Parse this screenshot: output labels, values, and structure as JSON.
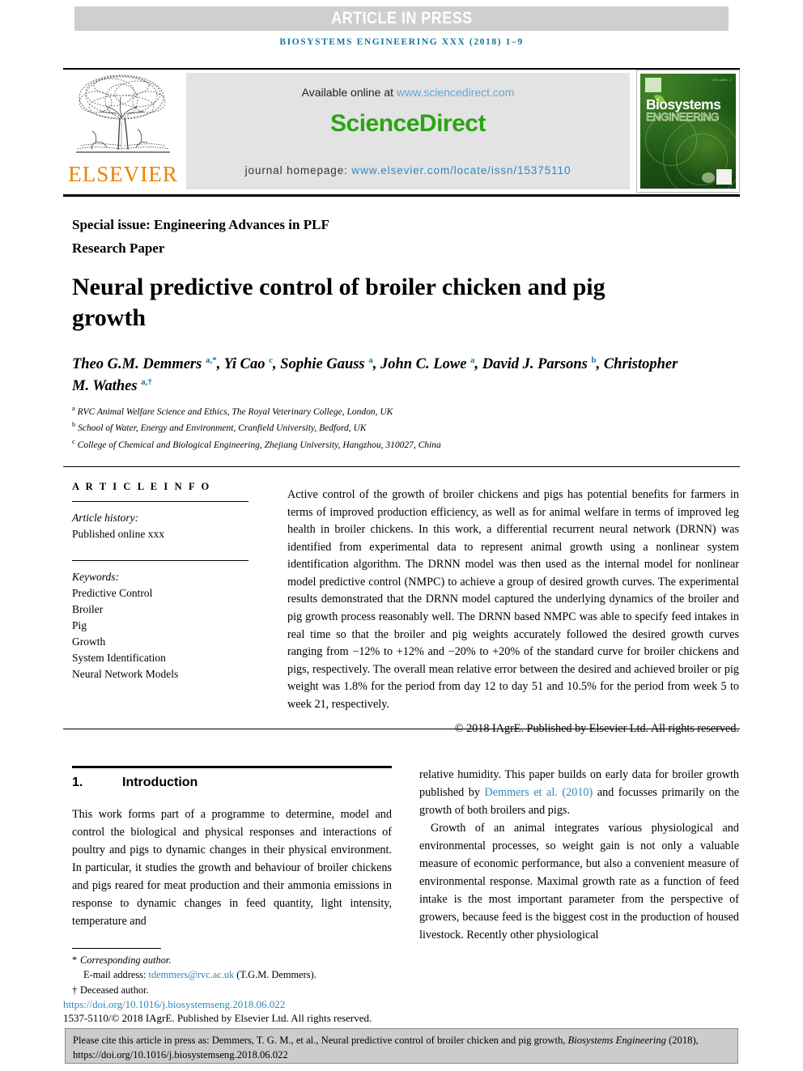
{
  "banner": {
    "press_label": "ARTICLE IN PRESS",
    "running_head": "BIOSYSTEMS ENGINEERING XXX (2018) 1–9",
    "press_bg": "#cfcfcf",
    "running_head_color": "#16759c"
  },
  "masthead": {
    "elsevier_wordmark": "ELSEVIER",
    "elsevier_color": "#f08000",
    "available_prefix": "Available online at ",
    "available_url": "www.sciencedirect.com",
    "sciencedirect_logo": "ScienceDirect",
    "sciencedirect_color": "#2aa414",
    "homepage_prefix": "journal homepage: ",
    "homepage_url": "www.elsevier.com/locate/issn/15375110",
    "link_color": "#2e87bd",
    "cover": {
      "title": "Biosystems",
      "subtitle": "ENGINEERING",
      "issue_line": "VOLUME 1"
    }
  },
  "article": {
    "special_issue": "Special issue: Engineering Advances in PLF",
    "paper_type": "Research Paper",
    "title": "Neural predictive control of broiler chicken and pig growth",
    "authors": [
      {
        "name": "Theo G.M. Demmers",
        "marks": "a,*",
        "sep": ", "
      },
      {
        "name": "Yi Cao",
        "marks": "c",
        "sep": ", "
      },
      {
        "name": "Sophie Gauss",
        "marks": "a",
        "sep": ", "
      },
      {
        "name": "John C. Lowe",
        "marks": "a",
        "sep": ", "
      },
      {
        "name": "David J. Parsons",
        "marks": "b",
        "sep": ", "
      },
      {
        "name": "Christopher M. Wathes",
        "marks": "a,†",
        "sep": ""
      }
    ],
    "affiliations": [
      {
        "mark": "a",
        "text": "RVC Animal Welfare Science and Ethics, The Royal Veterinary College, London, UK"
      },
      {
        "mark": "b",
        "text": "School of Water, Energy and Environment, Cranfield University, Bedford, UK"
      },
      {
        "mark": "c",
        "text": "College of Chemical and Biological Engineering, Zhejiang University, Hangzhou, 310027, China"
      }
    ]
  },
  "article_info": {
    "heading": "A R T I C L E  I N F O",
    "history_label": "Article history:",
    "history_value": "Published online xxx",
    "keywords_label": "Keywords:",
    "keywords": [
      "Predictive Control",
      "Broiler",
      "Pig",
      "Growth",
      "System Identification",
      "Neural Network Models"
    ]
  },
  "abstract": {
    "text": "Active control of the growth of broiler chickens and pigs has potential benefits for farmers in terms of improved production efficiency, as well as for animal welfare in terms of improved leg health in broiler chickens. In this work, a differential recurrent neural network (DRNN) was identified from experimental data to represent animal growth using a nonlinear system identification algorithm. The DRNN model was then used as the internal model for nonlinear model predictive control (NMPC) to achieve a group of desired growth curves. The experimental results demonstrated that the DRNN model captured the underlying dynamics of the broiler and pig growth process reasonably well. The DRNN based NMPC was able to specify feed intakes in real time so that the broiler and pig weights accurately followed the desired growth curves ranging from −12% to +12% and −20% to +20% of the standard curve for broiler chickens and pigs, respectively. The overall mean relative error between the desired and achieved broiler or pig weight was 1.8% for the period from day 12 to day 51 and 10.5% for the period from week 5 to week 21, respectively.",
    "copyright": "© 2018 IAgrE. Published by Elsevier Ltd. All rights reserved."
  },
  "section": {
    "number": "1.",
    "title": "Introduction"
  },
  "body": {
    "left_paragraph": "This work forms part of a programme to determine, model and control the biological and physical responses and interactions of poultry and pigs to dynamic changes in their physical environment. In particular, it studies the growth and behaviour of broiler chickens and pigs reared for meat production and their ammonia emissions in response to dynamic changes in feed quantity, light intensity, temperature and",
    "right_paragraph_1_pre": "relative humidity. This paper builds on early data for broiler growth published by ",
    "right_paragraph_1_link": "Demmers et al. (2010)",
    "right_paragraph_1_post": " and focusses primarily on the growth of both broilers and pigs.",
    "right_paragraph_2": "Growth of an animal integrates various physiological and environmental processes, so weight gain is not only a valuable measure of economic performance, but also a convenient measure of environmental response. Maximal growth rate as a function of feed intake is the most important parameter from the perspective of growers, because feed is the biggest cost in the production of housed livestock. Recently other physiological"
  },
  "footnotes": {
    "corresponding_mark": "*",
    "corresponding_text": "Corresponding author.",
    "email_label": "E-mail address: ",
    "email_address": "tdemmers@rvc.ac.uk",
    "email_owner": " (T.G.M. Demmers).",
    "deceased_mark": "†",
    "deceased_text": "Deceased author.",
    "doi": "https://doi.org/10.1016/j.biosystemseng.2018.06.022",
    "issn_line": "1537-5110/© 2018 IAgrE. Published by Elsevier Ltd. All rights reserved."
  },
  "cite_box": {
    "pre": "Please cite this article in press as: Demmers, T. G. M., et al., Neural predictive control of broiler chicken and pig growth, ",
    "journal": "Biosystems Engineering",
    "post": " (2018), https://doi.org/10.1016/j.biosystemseng.2018.06.022"
  }
}
